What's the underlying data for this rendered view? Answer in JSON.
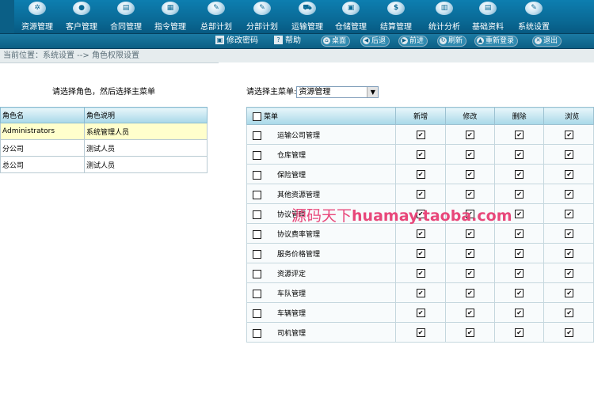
{
  "nav": {
    "items": [
      {
        "label": "资源管理",
        "glyph": "✲"
      },
      {
        "label": "客户管理",
        "glyph": "●"
      },
      {
        "label": "合同管理",
        "glyph": "▤"
      },
      {
        "label": "指令管理",
        "glyph": "▦"
      },
      {
        "label": "总部计划",
        "glyph": "✎"
      },
      {
        "label": "分部计划",
        "glyph": "✎"
      },
      {
        "label": "运输管理",
        "glyph": "⛟"
      },
      {
        "label": "仓储管理",
        "glyph": "▣"
      },
      {
        "label": "结算管理",
        "glyph": "$"
      },
      {
        "label": "统计分析",
        "glyph": "▥"
      },
      {
        "label": "基础资料",
        "glyph": "▤"
      },
      {
        "label": "系统设置",
        "glyph": "✎"
      }
    ]
  },
  "toolbar": {
    "change_password": "修改密码",
    "help": "帮助",
    "home": "桌面",
    "back": "后退",
    "forward": "前进",
    "refresh": "刷新",
    "relogin": "重新登录",
    "logout": "退出"
  },
  "breadcrumb": "当前位置：系统设置 --> 角色权限设置",
  "left": {
    "hint": "请选择角色，然后选择主菜单",
    "headers": [
      "角色名",
      "角色说明"
    ],
    "rows": [
      {
        "name": "Administrators",
        "desc": "系统管理人员",
        "selected": true
      },
      {
        "name": "分公司",
        "desc": "测试人员",
        "selected": false
      },
      {
        "name": "总公司",
        "desc": "测试人员",
        "selected": false
      }
    ]
  },
  "right": {
    "picker_label": "请选择主菜单:",
    "picker_value": "资源管理",
    "headers": {
      "menu": "菜单",
      "add": "新增",
      "edit": "修改",
      "delete": "删除",
      "browse": "浏览"
    },
    "rows": [
      {
        "name": "运输公司管理",
        "checked": false,
        "add": true,
        "edit": true,
        "delete": true,
        "browse": true
      },
      {
        "name": "仓库管理",
        "checked": false,
        "add": true,
        "edit": true,
        "delete": true,
        "browse": true
      },
      {
        "name": "保险管理",
        "checked": false,
        "add": true,
        "edit": true,
        "delete": true,
        "browse": true
      },
      {
        "name": "其他资源管理",
        "checked": false,
        "add": true,
        "edit": true,
        "delete": true,
        "browse": true
      },
      {
        "name": "协议管理",
        "checked": false,
        "add": true,
        "edit": true,
        "delete": true,
        "browse": true
      },
      {
        "name": "协议费率管理",
        "checked": false,
        "add": true,
        "edit": true,
        "delete": true,
        "browse": true
      },
      {
        "name": "服务价格管理",
        "checked": false,
        "add": true,
        "edit": true,
        "delete": true,
        "browse": true
      },
      {
        "name": "资源评定",
        "checked": false,
        "add": true,
        "edit": true,
        "delete": true,
        "browse": true
      },
      {
        "name": "车队管理",
        "checked": false,
        "add": true,
        "edit": true,
        "delete": true,
        "browse": true
      },
      {
        "name": "车辆管理",
        "checked": false,
        "add": true,
        "edit": true,
        "delete": true,
        "browse": true
      },
      {
        "name": "司机管理",
        "checked": false,
        "add": true,
        "edit": true,
        "delete": true,
        "browse": true
      }
    ]
  },
  "watermark": {
    "cn": "源码天下",
    "latin": "huamay.taoba.com"
  }
}
